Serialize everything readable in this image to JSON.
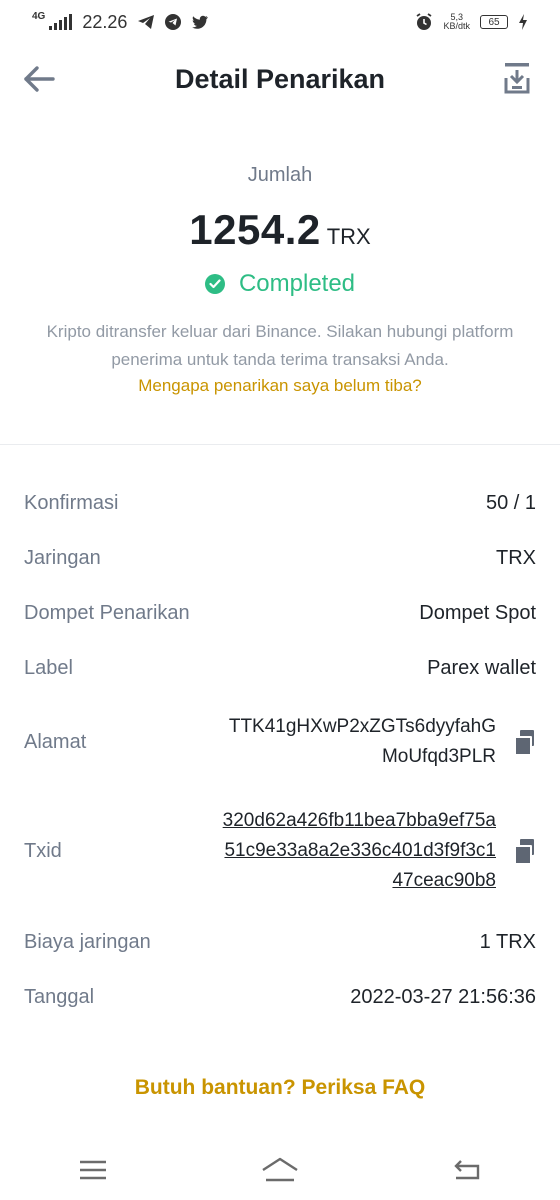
{
  "statusbar": {
    "network": "4G",
    "time": "22.26",
    "speed_value": "5,3",
    "speed_unit": "KB/dtk",
    "battery": "65"
  },
  "header": {
    "title": "Detail Penarikan"
  },
  "summary": {
    "amount_label": "Jumlah",
    "amount": "1254.2",
    "unit": "TRX",
    "status": "Completed",
    "description": "Kripto ditransfer keluar dari Binance. Silakan hubungi platform penerima untuk tanda terima transaksi Anda.",
    "help_link": "Mengapa penarikan saya belum tiba?"
  },
  "details": {
    "confirmations": {
      "label": "Konfirmasi",
      "value": "50 / 1"
    },
    "network": {
      "label": "Jaringan",
      "value": "TRX"
    },
    "wallet": {
      "label": "Dompet Penarikan",
      "value": "Dompet Spot"
    },
    "tag": {
      "label": "Label",
      "value": "Parex wallet"
    },
    "address": {
      "label": "Alamat",
      "line1": "TTK41gHXwP2xZGTs6dyyfahG",
      "line2": "MoUfqd3PLR"
    },
    "txid": {
      "label": "Txid",
      "line1": "320d62a426fb11bea7bba9ef75a",
      "line2": "51c9e33a8a2e336c401d3f9f3c1",
      "line3": "47ceac90b8"
    },
    "fee": {
      "label": "Biaya jaringan",
      "value": "1 TRX"
    },
    "date": {
      "label": "Tanggal",
      "value": "2022-03-27 21:56:36"
    }
  },
  "footer": {
    "faq": "Butuh bantuan? Periksa FAQ"
  },
  "colors": {
    "accent": "#c99400",
    "success": "#2ebd85",
    "text": "#1e2329",
    "secondary": "#707a8a"
  }
}
